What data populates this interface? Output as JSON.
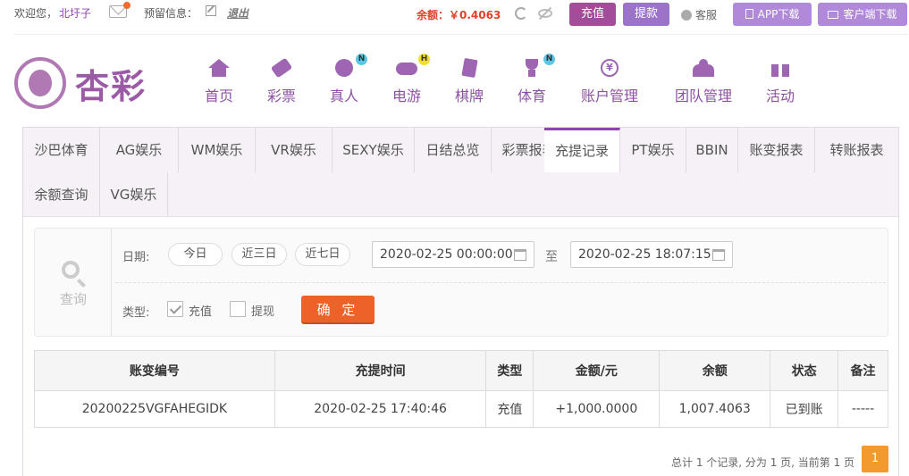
{
  "topbar": {
    "welcome": "欢迎您，",
    "username": "北圩子",
    "reserve": "预留信息：",
    "logout": "退出",
    "balance": "余额：￥0.4063",
    "recharge": "充值",
    "withdraw": "提款",
    "service": "客服",
    "app_download": "APP下载",
    "client_download": "客户端下载",
    "colors": {
      "accent": "#a24c9a",
      "balance": "#e0412c"
    }
  },
  "logo": {
    "text": "杏彩"
  },
  "nav": [
    {
      "label": "首页",
      "icon": "home-icon",
      "badge": ""
    },
    {
      "label": "彩票",
      "icon": "lottery-ticket-icon",
      "badge": ""
    },
    {
      "label": "真人",
      "icon": "live-dealer-icon",
      "badge": "N"
    },
    {
      "label": "电游",
      "icon": "gamepad-icon",
      "badge": "H"
    },
    {
      "label": "棋牌",
      "icon": "cards-icon",
      "badge": ""
    },
    {
      "label": "体育",
      "icon": "trophy-icon",
      "badge": "N"
    },
    {
      "label": "账户管理",
      "icon": "yen-coin-icon",
      "badge": ""
    },
    {
      "label": "团队管理",
      "icon": "team-icon",
      "badge": ""
    },
    {
      "label": "活动",
      "icon": "gift-icon",
      "badge": ""
    }
  ],
  "tabs": [
    "沙巴体育",
    "AG娱乐",
    "WM娱乐",
    "VR娱乐",
    "SEXY娱乐",
    "日结总览",
    "彩票报表",
    "充提记录",
    "PT娱乐",
    "BBIN",
    "账变报表",
    "转账报表",
    "余额查询",
    "VG娱乐"
  ],
  "active_tab": "充提记录",
  "query": {
    "side_label": "查询",
    "date_label": "日期:",
    "today": "今日",
    "three_days": "近三日",
    "seven_days": "近七日",
    "start": "2020-02-25 00:00:00",
    "to": "至",
    "end": "2020-02-25 18:07:15",
    "type_label": "类型:",
    "opt_recharge": "充值",
    "opt_withdraw": "提现",
    "confirm": "确 定"
  },
  "table": {
    "headers": [
      "账变编号",
      "充提时间",
      "类型",
      "金额/元",
      "余额",
      "状态",
      "备注"
    ],
    "rows": [
      [
        "20200225VGFAHEGIDK",
        "2020-02-25 17:40:46",
        "充值",
        "+1,000.0000",
        "1,007.4063",
        "已到账",
        "-----"
      ]
    ]
  },
  "pager": {
    "summary": "总计 1 个记录, 分为 1 页, 当前第 1 页",
    "current": "1"
  }
}
